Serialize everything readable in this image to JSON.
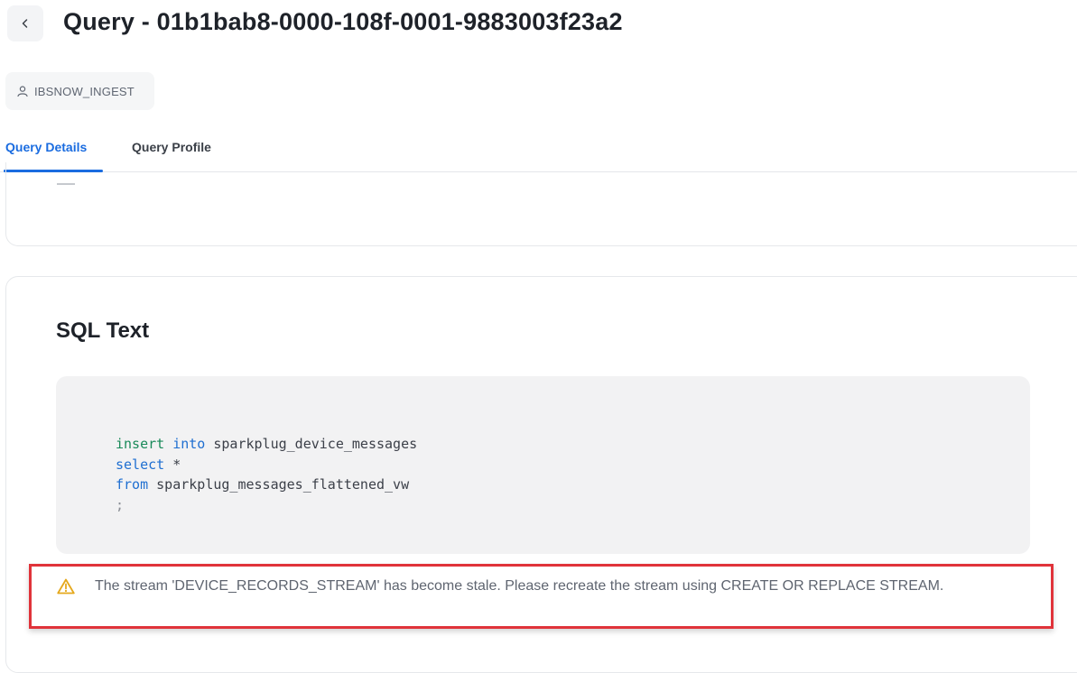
{
  "header": {
    "title": "Query - 01b1bab8-0000-108f-0001-9883003f23a2"
  },
  "user_chip": {
    "label": "IBSNOW_INGEST"
  },
  "tabs": [
    {
      "label": "Query Details",
      "active": true
    },
    {
      "label": "Query Profile",
      "active": false
    }
  ],
  "sql_section": {
    "heading": "SQL Text",
    "code": {
      "line1_kw1": "insert",
      "line1_kw2": "into",
      "line1_rest": " sparkplug_device_messages",
      "line2_kw": "select",
      "line2_rest": " *",
      "line3_kw": "from",
      "line3_rest": " sparkplug_messages_flattened_vw",
      "line4": ";"
    }
  },
  "warning": {
    "icon": "warning-triangle-icon",
    "message": "The stream 'DEVICE_RECORDS_STREAM' has become stale. Please recreate the stream using CREATE OR REPLACE STREAM."
  },
  "colors": {
    "accent": "#1a6ce0",
    "warning_border": "#e0333a",
    "warning_icon": "#e5a81c",
    "keyword_green": "#1a8a5a",
    "keyword_blue": "#1f6fd1"
  }
}
